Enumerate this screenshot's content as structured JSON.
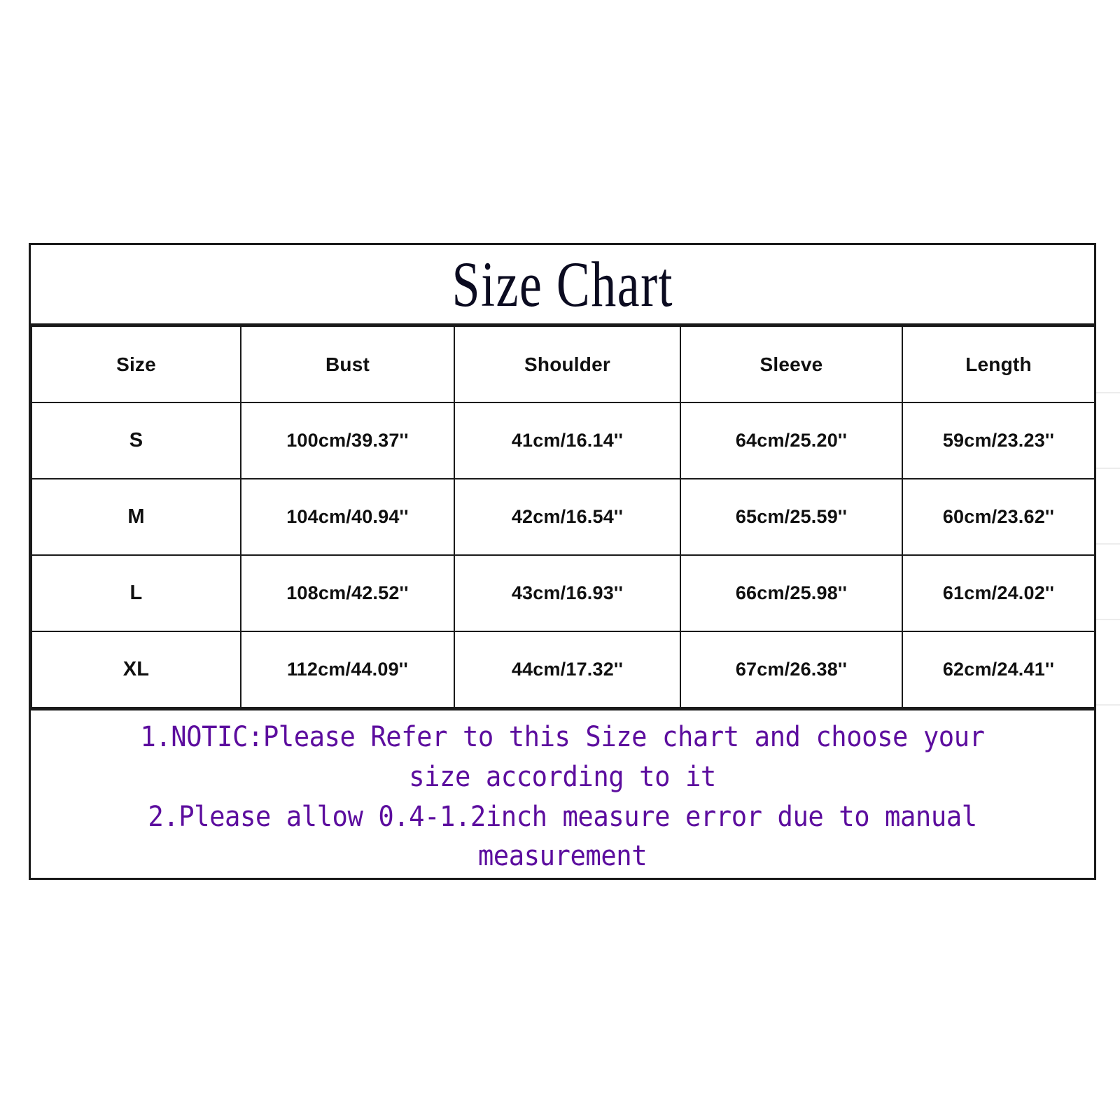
{
  "document": {
    "title": "Size Chart",
    "table": {
      "headers": [
        "Size",
        "Bust",
        "Shoulder",
        "Sleeve",
        "Length"
      ],
      "rows": [
        {
          "size": "S",
          "bust": "100cm/39.37''",
          "shoulder": "41cm/16.14''",
          "sleeve": "64cm/25.20''",
          "length": "59cm/23.23''"
        },
        {
          "size": "M",
          "bust": "104cm/40.94''",
          "shoulder": "42cm/16.54''",
          "sleeve": "65cm/25.59''",
          "length": "60cm/23.62''"
        },
        {
          "size": "L",
          "bust": "108cm/42.52''",
          "shoulder": "43cm/16.93''",
          "sleeve": "66cm/25.98''",
          "length": "61cm/24.02''"
        },
        {
          "size": "XL",
          "bust": "112cm/44.09''",
          "shoulder": "44cm/17.32''",
          "sleeve": "67cm/26.38''",
          "length": "62cm/24.41''"
        }
      ]
    },
    "notice": {
      "lines": [
        "1.NOTIC:Please Refer to this Size chart and choose your",
        "size according to it",
        "2.Please allow 0.4-1.2inch measure error due to manual",
        "measurement"
      ]
    },
    "colors": {
      "notice_text": "#5c0d9e",
      "border": "#1a1a1a",
      "title_text": "#0b0b20",
      "background": "#ffffff"
    }
  }
}
